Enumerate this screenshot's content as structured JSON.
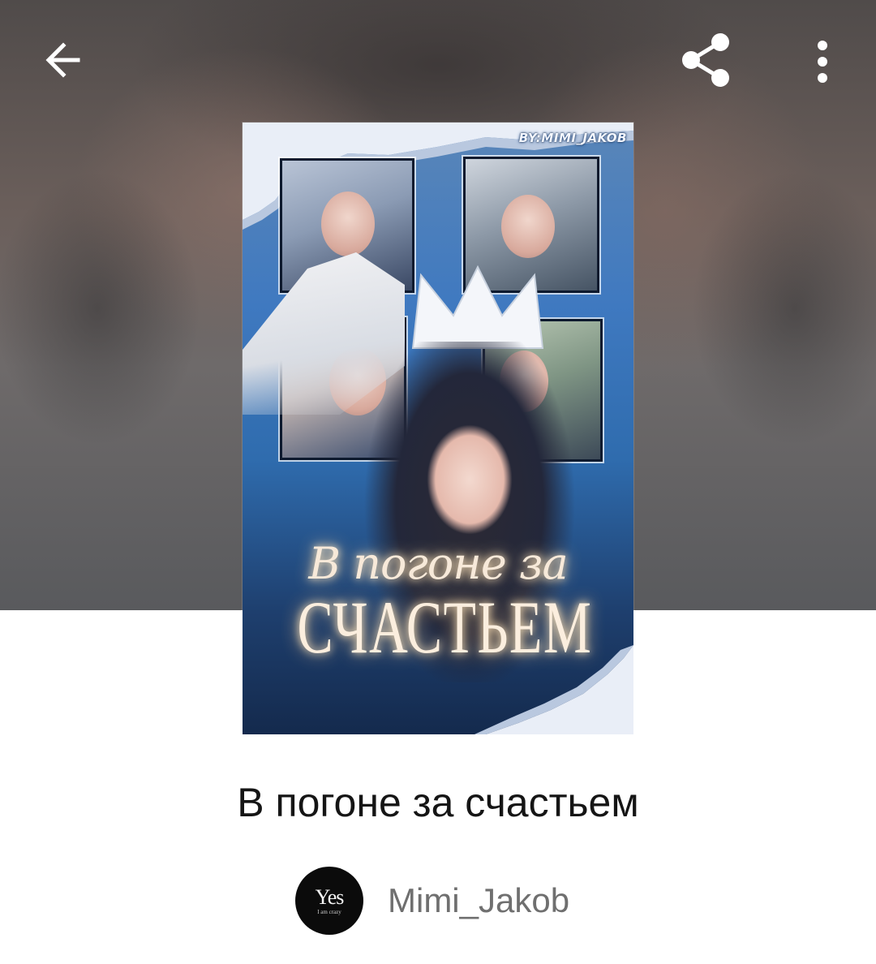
{
  "nav": {
    "back_icon": "arrow-left-icon",
    "share_icon": "share-icon",
    "more_icon": "more-vertical-icon"
  },
  "cover": {
    "byline": "BY:MIMI_JAKOB",
    "title_line1": "В погоне за",
    "title_line2": "СЧАСТЬЕМ"
  },
  "book": {
    "title": "В погоне за счастьем"
  },
  "author": {
    "avatar_text": "Yes",
    "avatar_subtext": "I am crazy",
    "name": "Mimi_Jakob"
  },
  "colors": {
    "icon": "#ffffff",
    "title_text": "#151515",
    "author_text": "#6f6f6f",
    "avatar_bg": "#0b0b0b"
  }
}
